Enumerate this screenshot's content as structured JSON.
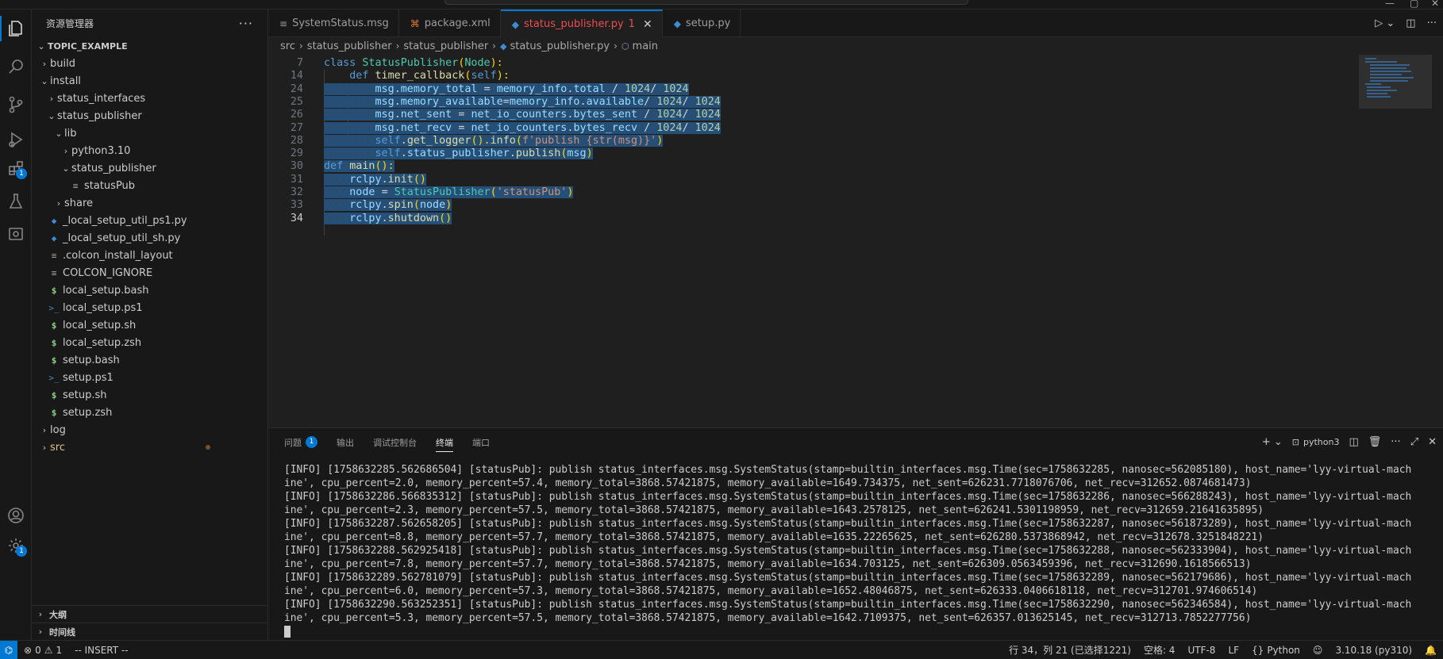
{
  "sidebar": {
    "title": "资源管理器",
    "more": "···",
    "section": "TOPIC_EXAMPLE",
    "tree": [
      {
        "label": "build",
        "chev": "›",
        "icon": "",
        "iconType": "",
        "depth": 1
      },
      {
        "label": "install",
        "chev": "⌄",
        "icon": "",
        "iconType": "",
        "depth": 1
      },
      {
        "label": "status_interfaces",
        "chev": "›",
        "icon": "",
        "iconType": "",
        "depth": 2
      },
      {
        "label": "status_publisher",
        "chev": "⌄",
        "icon": "",
        "iconType": "",
        "depth": 2
      },
      {
        "label": "lib",
        "chev": "⌄",
        "icon": "",
        "iconType": "",
        "depth": 3
      },
      {
        "label": "python3.10",
        "chev": "›",
        "icon": "",
        "iconType": "",
        "depth": 4
      },
      {
        "label": "status_publisher",
        "chev": "⌄",
        "icon": "",
        "iconType": "",
        "depth": 4
      },
      {
        "label": "statusPub",
        "chev": "",
        "icon": "≡",
        "iconType": "lines",
        "depth": 5
      },
      {
        "label": "share",
        "chev": "›",
        "icon": "",
        "iconType": "",
        "depth": 3
      },
      {
        "label": "_local_setup_util_ps1.py",
        "chev": "",
        "icon": "◆",
        "iconType": "py",
        "depth": 2
      },
      {
        "label": "_local_setup_util_sh.py",
        "chev": "",
        "icon": "◆",
        "iconType": "py",
        "depth": 2
      },
      {
        "label": ".colcon_install_layout",
        "chev": "",
        "icon": "≡",
        "iconType": "lines",
        "depth": 2
      },
      {
        "label": "COLCON_IGNORE",
        "chev": "",
        "icon": "≡",
        "iconType": "lines",
        "depth": 2
      },
      {
        "label": "local_setup.bash",
        "chev": "",
        "icon": "$",
        "iconType": "dollar",
        "depth": 2
      },
      {
        "label": "local_setup.ps1",
        "chev": "",
        "icon": ">_",
        "iconType": "ps",
        "depth": 2
      },
      {
        "label": "local_setup.sh",
        "chev": "",
        "icon": "$",
        "iconType": "dollar",
        "depth": 2
      },
      {
        "label": "local_setup.zsh",
        "chev": "",
        "icon": "$",
        "iconType": "dollar",
        "depth": 2
      },
      {
        "label": "setup.bash",
        "chev": "",
        "icon": "$",
        "iconType": "dollar",
        "depth": 2
      },
      {
        "label": "setup.ps1",
        "chev": "",
        "icon": ">_",
        "iconType": "ps",
        "depth": 2
      },
      {
        "label": "setup.sh",
        "chev": "",
        "icon": "$",
        "iconType": "dollar",
        "depth": 2
      },
      {
        "label": "setup.zsh",
        "chev": "",
        "icon": "$",
        "iconType": "dollar",
        "depth": 2
      },
      {
        "label": "log",
        "chev": "›",
        "icon": "",
        "iconType": "",
        "depth": 1
      },
      {
        "label": "src",
        "chev": "›",
        "icon": "",
        "iconType": "",
        "depth": 1,
        "modified": true
      }
    ],
    "outline": "大纲",
    "timeline": "时间线"
  },
  "activity": {
    "extensions_badge": "1",
    "settings_badge": "1"
  },
  "tabs": [
    {
      "label": "SystemStatus.msg",
      "icon": "≡",
      "iconColor": "#9d9d9d",
      "active": false
    },
    {
      "label": "package.xml",
      "icon": "⌘",
      "iconColor": "#e37933",
      "active": false
    },
    {
      "label": "status_publisher.py",
      "icon": "◆",
      "iconColor": "#3c8dd4",
      "active": true,
      "errors": "1"
    },
    {
      "label": "setup.py",
      "icon": "◆",
      "iconColor": "#3c8dd4",
      "active": false
    }
  ],
  "breadcrumb": [
    "src",
    "status_publisher",
    "status_publisher",
    "status_publisher.py",
    "main"
  ],
  "editor": {
    "lines": [
      {
        "n": "7",
        "code": "class StatusPublisher(Node):"
      },
      {
        "n": "14",
        "code": "    def timer_callback(self):"
      },
      {
        "n": "24",
        "code": "        msg.memory_total = memory_info.total / 1024/ 1024"
      },
      {
        "n": "25",
        "code": "        msg.memory_available=memory_info.available/ 1024/ 1024"
      },
      {
        "n": "26",
        "code": "        msg.net_sent = net_io_counters.bytes_sent / 1024/ 1024"
      },
      {
        "n": "27",
        "code": "        msg.net_recv = net_io_counters.bytes_recv / 1024/ 1024"
      },
      {
        "n": "28",
        "code": "        self.get_logger().info(f'publish {str(msg)}')"
      },
      {
        "n": "29",
        "code": "        self.status_publisher.publish(msg)"
      },
      {
        "n": "30",
        "code": "def main():"
      },
      {
        "n": "31",
        "code": "    rclpy.init()"
      },
      {
        "n": "32",
        "code": "    node = StatusPublisher('statusPub')"
      },
      {
        "n": "33",
        "code": "    rclpy.spin(node)"
      },
      {
        "n": "34",
        "code": "    rclpy.shutdown()"
      }
    ],
    "current_line": "34"
  },
  "panel": {
    "tabs": [
      {
        "label": "问题",
        "badge": "1"
      },
      {
        "label": "输出"
      },
      {
        "label": "调试控制台"
      },
      {
        "label": "终端",
        "active": true
      },
      {
        "label": "端口"
      }
    ],
    "terminal_name": "python3",
    "terminal_lines": [
      "[INFO] [1758632285.562686504] [statusPub]: publish status_interfaces.msg.SystemStatus(stamp=builtin_interfaces.msg.Time(sec=1758632285, nanosec=562085180), host_name='lyy-virtual-mach",
      "ine', cpu_percent=2.0, memory_percent=57.4, memory_total=3868.57421875, memory_available=1649.734375, net_sent=626231.7718076706, net_recv=312652.0874681473)",
      "[INFO] [1758632286.566835312] [statusPub]: publish status_interfaces.msg.SystemStatus(stamp=builtin_interfaces.msg.Time(sec=1758632286, nanosec=566288243), host_name='lyy-virtual-mach",
      "ine', cpu_percent=2.3, memory_percent=57.5, memory_total=3868.57421875, memory_available=1643.2578125, net_sent=626241.5301198959, net_recv=312659.21641635895)",
      "[INFO] [1758632287.562658205] [statusPub]: publish status_interfaces.msg.SystemStatus(stamp=builtin_interfaces.msg.Time(sec=1758632287, nanosec=561873289), host_name='lyy-virtual-mach",
      "ine', cpu_percent=8.8, memory_percent=57.7, memory_total=3868.57421875, memory_available=1635.22265625, net_sent=626280.5373868942, net_recv=312678.3251848221)",
      "[INFO] [1758632288.562925418] [statusPub]: publish status_interfaces.msg.SystemStatus(stamp=builtin_interfaces.msg.Time(sec=1758632288, nanosec=562333904), host_name='lyy-virtual-mach",
      "ine', cpu_percent=7.8, memory_percent=57.7, memory_total=3868.57421875, memory_available=1634.703125, net_sent=626309.0563459396, net_recv=312690.1618566513)",
      "[INFO] [1758632289.562781079] [statusPub]: publish status_interfaces.msg.SystemStatus(stamp=builtin_interfaces.msg.Time(sec=1758632289, nanosec=562179686), host_name='lyy-virtual-mach",
      "ine', cpu_percent=6.0, memory_percent=57.3, memory_total=3868.57421875, memory_available=1652.48046875, net_sent=626333.0406618118, net_recv=312701.974606514)",
      "[INFO] [1758632290.563252351] [statusPub]: publish status_interfaces.msg.SystemStatus(stamp=builtin_interfaces.msg.Time(sec=1758632290, nanosec=562346584), host_name='lyy-virtual-mach",
      "ine', cpu_percent=5.3, memory_percent=57.5, memory_total=3868.57421875, memory_available=1642.7109375, net_sent=626357.013625145, net_recv=312713.7852277756)"
    ]
  },
  "statusbar": {
    "errors": "0",
    "warnings": "1",
    "mode": "-- INSERT --",
    "position": "行 34，列 21 (已选择1221)",
    "spaces": "空格: 4",
    "encoding": "UTF-8",
    "eol": "LF",
    "language": "Python",
    "interpreter": "3.10.18 (py310)"
  },
  "colors": {
    "accent": "#0078d4",
    "error": "#f14c4c",
    "selection": "#264f78"
  }
}
